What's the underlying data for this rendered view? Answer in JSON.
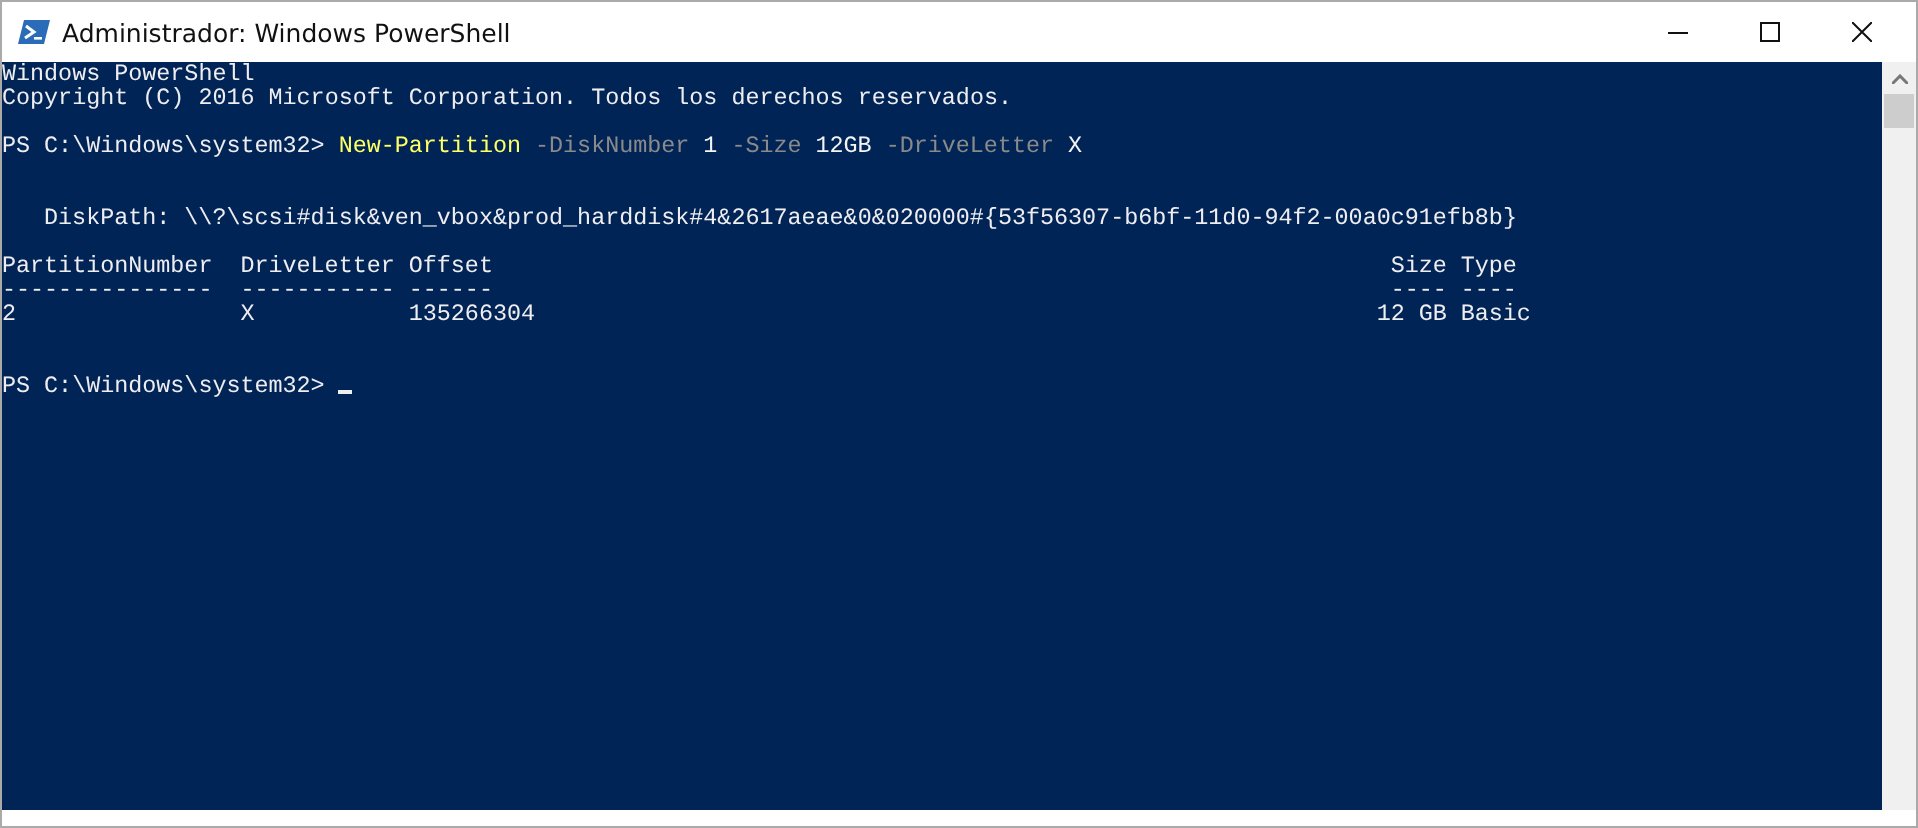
{
  "window": {
    "title": "Administrador: Windows PowerShell"
  },
  "console": {
    "lines": [
      {
        "kind": "output",
        "segments": [
          {
            "kind": "text",
            "text": "Windows PowerShell"
          }
        ]
      },
      {
        "kind": "output",
        "segments": [
          {
            "kind": "text",
            "text": "Copyright (C) 2016 Microsoft Corporation. Todos los derechos reservados."
          }
        ]
      },
      {
        "kind": "blank"
      },
      {
        "kind": "prompt",
        "segments": [
          {
            "kind": "text",
            "text": "PS C:\\Windows\\system32>"
          },
          {
            "kind": "command",
            "text": "New-Partition"
          },
          {
            "kind": "parameter",
            "text": "-DiskNumber"
          },
          {
            "kind": "value",
            "text": "1"
          },
          {
            "kind": "parameter",
            "text": "-Size"
          },
          {
            "kind": "value",
            "text": "12GB"
          },
          {
            "kind": "parameter",
            "text": "-DriveLetter"
          },
          {
            "kind": "value",
            "text": "X"
          }
        ]
      },
      {
        "kind": "blank"
      },
      {
        "kind": "blank"
      },
      {
        "kind": "output",
        "indent": true,
        "segments": [
          {
            "kind": "text",
            "text": "DiskPath: \\\\?\\scsi#disk&ven_vbox&prod_harddisk#4&2617aeae&0&020000#{53f56307-b6bf-11d0-94f2-00a0c91efb8b}"
          }
        ]
      },
      {
        "kind": "blank"
      },
      {
        "kind": "table",
        "columns": [
          {
            "heading": "PartitionNumber",
            "rule": "---------------"
          },
          {
            "heading": "DriveLetter",
            "rule": "-----------"
          },
          {
            "heading": "Offset",
            "rule": "------"
          },
          {
            "heading": "Size",
            "rule": "----"
          },
          {
            "heading": "Type",
            "rule": "----"
          }
        ],
        "rows": [
          [
            "2",
            "X",
            "135266304",
            "12 GB",
            "Basic"
          ]
        ]
      },
      {
        "kind": "blank"
      },
      {
        "kind": "blank"
      },
      {
        "kind": "prompt",
        "cursor": true,
        "segments": [
          {
            "kind": "text",
            "text": "PS C:\\Windows\\system32>"
          }
        ]
      }
    ]
  }
}
